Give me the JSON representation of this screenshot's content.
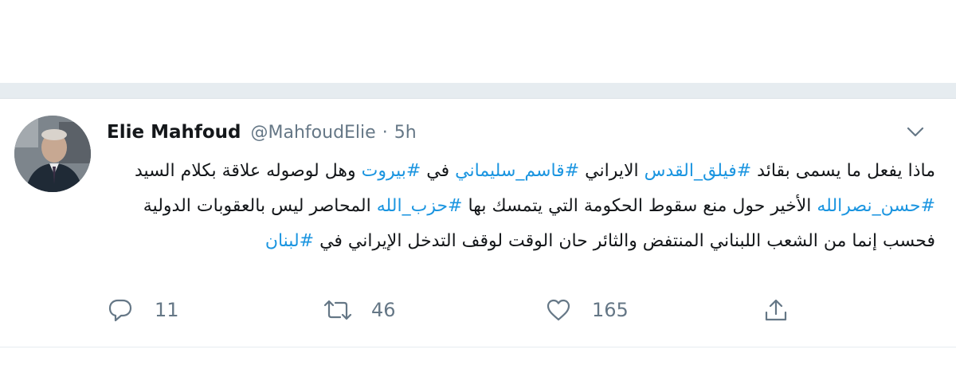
{
  "tweet": {
    "author_name": "Elie Mahfoud",
    "handle": "@MahfoudElie",
    "separator": "·",
    "time": "5h",
    "text_runs": [
      {
        "text": "ماذا يفعل ما يسمى بقائد ",
        "hashtag": false
      },
      {
        "text": "#فيلق_القدس",
        "hashtag": true
      },
      {
        "text": " الايراني ",
        "hashtag": false
      },
      {
        "text": "#قاسم_سليماني",
        "hashtag": true
      },
      {
        "text": " في ",
        "hashtag": false
      },
      {
        "text": "#بيروت",
        "hashtag": true
      },
      {
        "text": " وهل لوصوله علاقة بكلام السيد ",
        "hashtag": false
      },
      {
        "text": "#حسن_نصرالله",
        "hashtag": true
      },
      {
        "text": " الأخير حول منع سقوط الحكومة التي يتمسك بها ",
        "hashtag": false
      },
      {
        "text": "#حزب_الله",
        "hashtag": true
      },
      {
        "text": " المحاصر ليس بالعقوبات الدولية فحسب إنما من الشعب اللبناني المنتفض والثائر حان الوقت لوقف التدخل الإيراني في ",
        "hashtag": false
      },
      {
        "text": "#لبنان",
        "hashtag": true
      }
    ],
    "actions": {
      "reply": {
        "icon": "reply-icon",
        "count": "11"
      },
      "retweet": {
        "icon": "retweet-icon",
        "count": "46"
      },
      "like": {
        "icon": "heart-icon",
        "count": "165"
      },
      "share": {
        "icon": "share-icon"
      }
    }
  },
  "colors": {
    "hashtag": "#1b95e0",
    "secondary_text": "#657786",
    "separator_band": "#e6ecf0"
  }
}
